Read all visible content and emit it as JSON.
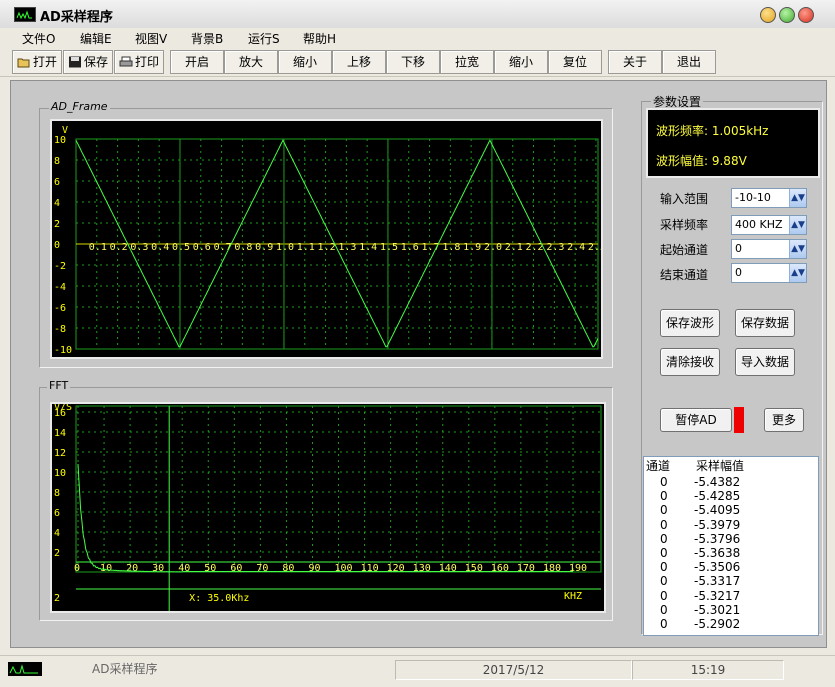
{
  "window": {
    "title": "AD采样程序"
  },
  "menu": [
    "文件O",
    "编辑E",
    "视图V",
    "背景B",
    "运行S",
    "帮助H"
  ],
  "toolbar": {
    "open": "打开",
    "save": "保存",
    "print": "打印",
    "commands": [
      "开启",
      "放大",
      "缩小",
      "上移",
      "下移",
      "拉宽",
      "缩小",
      "复位",
      "关于",
      "退出"
    ]
  },
  "ad_frame": {
    "label": "AD_Frame",
    "y_unit": "V",
    "y_ticks": [
      "10",
      "8",
      "6",
      "4",
      "2",
      "0",
      "-2",
      "-4",
      "-6",
      "-8",
      "-10"
    ],
    "x_ticks": [
      "0.1",
      "0.2",
      "0.3",
      "0.4",
      "0.5",
      "0.6",
      "0.7",
      "0.8",
      "0.9",
      "1.0",
      "1.1",
      "1.2",
      "1.3",
      "1.4",
      "1.5",
      "1.6",
      "1.7",
      "1.8",
      "1.9",
      "2.0",
      "2.1",
      "2.2",
      "2.3",
      "2.4",
      "2.5"
    ]
  },
  "fft_frame": {
    "label": "FFT",
    "y_unit": "V/S",
    "y_ticks": [
      "16",
      "14",
      "12",
      "10",
      "8",
      "6",
      "4",
      "2"
    ],
    "x_ticks": [
      "0",
      "10",
      "20",
      "30",
      "40",
      "50",
      "60",
      "70",
      "80",
      "90",
      "100",
      "110",
      "120",
      "130",
      "140",
      "150",
      "160",
      "170",
      "180",
      "190"
    ],
    "cursor_readout": "X: 35.0Khz",
    "cursor_khz": 35.0,
    "x_unit": "KHZ",
    "bottom_left": "2"
  },
  "params": {
    "group_label": "参数设置",
    "freq_line": "波形频率: 1.005kHz",
    "amp_line": "波形幅值: 9.88V",
    "input_range_label": "输入范围",
    "input_range_value": "-10-10",
    "sample_rate_label": "采样频率",
    "sample_rate_value": "400 KHZ",
    "start_ch_label": "起始通道",
    "start_ch_value": "0",
    "end_ch_label": "结束通道",
    "end_ch_value": "0"
  },
  "buttons": {
    "save_wave": "保存波形",
    "save_data": "保存数据",
    "clear_recv": "清除接收",
    "import_data": "导入数据",
    "pause_ad": "暂停AD",
    "more": "更多"
  },
  "list": {
    "col_channel": "通道",
    "col_amp": "采样幅值",
    "rows": [
      [
        "0",
        "-5.4382"
      ],
      [
        "0",
        "-5.4285"
      ],
      [
        "0",
        "-5.4095"
      ],
      [
        "0",
        "-5.3979"
      ],
      [
        "0",
        "-5.3796"
      ],
      [
        "0",
        "-5.3638"
      ],
      [
        "0",
        "-5.3506"
      ],
      [
        "0",
        "-5.3317"
      ],
      [
        "0",
        "-5.3217"
      ],
      [
        "0",
        "-5.3021"
      ],
      [
        "0",
        "-5.2902"
      ]
    ]
  },
  "status": {
    "app": "AD采样程序",
    "date": "2017/5/12",
    "time": "15:19"
  },
  "colors": {
    "trace": "#44ff44",
    "grid": "#1d9b1d",
    "axis_text": "#ffff00",
    "info_text": "#ffff3c"
  }
}
